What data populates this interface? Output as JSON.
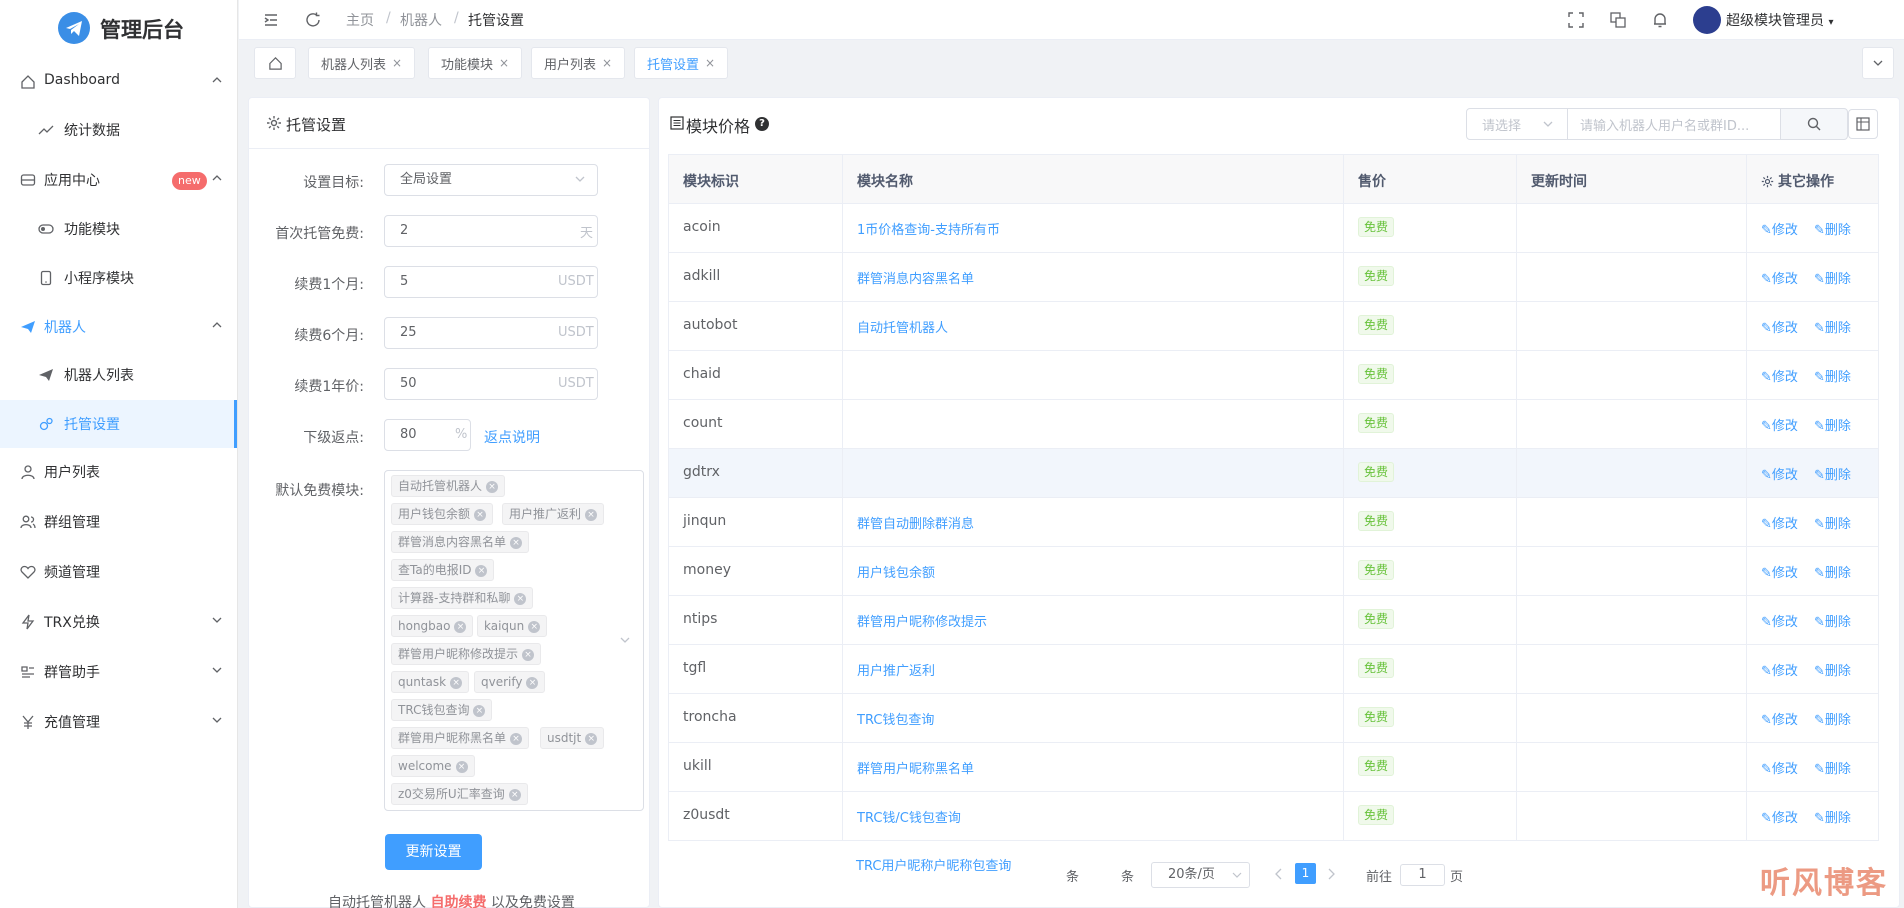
{
  "app": {
    "title": "管理后台"
  },
  "sidebar": {
    "items": [
      {
        "label": "Dashboard",
        "icon": "home-icon"
      },
      {
        "label": "统计数据",
        "icon": "trend-icon"
      },
      {
        "label": "应用中心",
        "icon": "app-icon",
        "badge": "new"
      },
      {
        "label": "功能模块",
        "icon": "toggle-icon"
      },
      {
        "label": "小程序模块",
        "icon": "phone-icon"
      },
      {
        "label": "机器人",
        "icon": "send-icon"
      },
      {
        "label": "机器人列表",
        "icon": "send-icon"
      },
      {
        "label": "托管设置",
        "icon": "settings-icon"
      },
      {
        "label": "用户列表",
        "icon": "user-icon"
      },
      {
        "label": "群组管理",
        "icon": "group-icon"
      },
      {
        "label": "频道管理",
        "icon": "heart-icon"
      },
      {
        "label": "TRX兑换",
        "icon": "bolt-icon"
      },
      {
        "label": "群管助手",
        "icon": "tool-icon"
      },
      {
        "label": "充值管理",
        "icon": "yen-icon"
      }
    ]
  },
  "header": {
    "breadcrumb": [
      "主页",
      "机器人",
      "托管设置"
    ],
    "user": "超级模块管理员"
  },
  "tabs": [
    {
      "label": "机器人列表"
    },
    {
      "label": "功能模块"
    },
    {
      "label": "用户列表"
    },
    {
      "label": "托管设置"
    }
  ],
  "settings": {
    "title": "托管设置",
    "fields": {
      "target_label": "设置目标:",
      "target_value": "全局设置",
      "free_label": "首次托管免费:",
      "free_value": "2",
      "free_unit": "天",
      "m1_label": "续费1个月:",
      "m1_value": "5",
      "m6_label": "续费6个月:",
      "m6_value": "25",
      "y1_label": "续费1年价:",
      "y1_value": "50",
      "currency": "USDT",
      "rebate_label": "下级返点:",
      "rebate_value": "80",
      "rebate_unit": "%",
      "rebate_link": "返点说明",
      "modules_label": "默认免费模块:"
    },
    "free_modules": [
      "自动托管机器人",
      "用户钱包余额",
      "用户推广返利",
      "群管消息内容黑名单",
      "查Ta的电报ID",
      "计算器-支持群和私聊",
      "hongbao",
      "kaiqun",
      "群管用户昵称修改提示",
      "quntask",
      "qverify",
      "TRC钱包查询",
      "群管用户昵称黑名单",
      "usdtjt",
      "welcome",
      "z0交易所U汇率查询"
    ],
    "submit": "更新设置",
    "footer": {
      "pre": "自动托管机器人 ",
      "hl": "自助续费",
      "post": " 以及免费设置"
    }
  },
  "prices": {
    "title": "模块价格",
    "select_placeholder": "请选择",
    "search_placeholder": "请输入机器人用户名或群ID...",
    "columns": [
      "模块标识",
      "模块名称",
      "售价",
      "更新时间",
      "其它操作"
    ],
    "rows": [
      {
        "id": "acoin",
        "name": "1币价格查询-支持所有币",
        "price": "免费"
      },
      {
        "id": "adkill",
        "name": "群管消息内容黑名单",
        "price": "免费"
      },
      {
        "id": "autobot",
        "name": "自动托管机器人",
        "price": "免费"
      },
      {
        "id": "chaid",
        "name": "",
        "price": "免费"
      },
      {
        "id": "count",
        "name": "",
        "price": "免费"
      },
      {
        "id": "gdtrx",
        "name": "",
        "price": "免费"
      },
      {
        "id": "jinqun",
        "name": "群管自动删除群消息",
        "price": "免费"
      },
      {
        "id": "money",
        "name": "用户钱包余额",
        "price": "免费"
      },
      {
        "id": "ntips",
        "name": "群管用户昵称修改提示",
        "price": "免费"
      },
      {
        "id": "tgfl",
        "name": "用户推广返利",
        "price": "免费"
      },
      {
        "id": "troncha",
        "name": "TRC钱包查询",
        "price": "免费"
      },
      {
        "id": "ukill",
        "name": "群管用户昵称黑名单",
        "price": "免费"
      },
      {
        "id": "z0usdt",
        "name": "TRC钱/C钱包查询",
        "price": "免费"
      }
    ],
    "edit": "修改",
    "delete": "删除",
    "extra_row": "TRC用户昵称户昵称包查询"
  },
  "pagination": {
    "tiao1": "条",
    "tiao2": "条",
    "size": "20条/页",
    "page": "1",
    "goto": "前往",
    "goto_value": "1",
    "page_suffix": "页"
  },
  "watermark": "听风博客",
  "colors": {
    "primary": "#409eff",
    "success": "#67c23a",
    "danger": "#f56c6c"
  }
}
